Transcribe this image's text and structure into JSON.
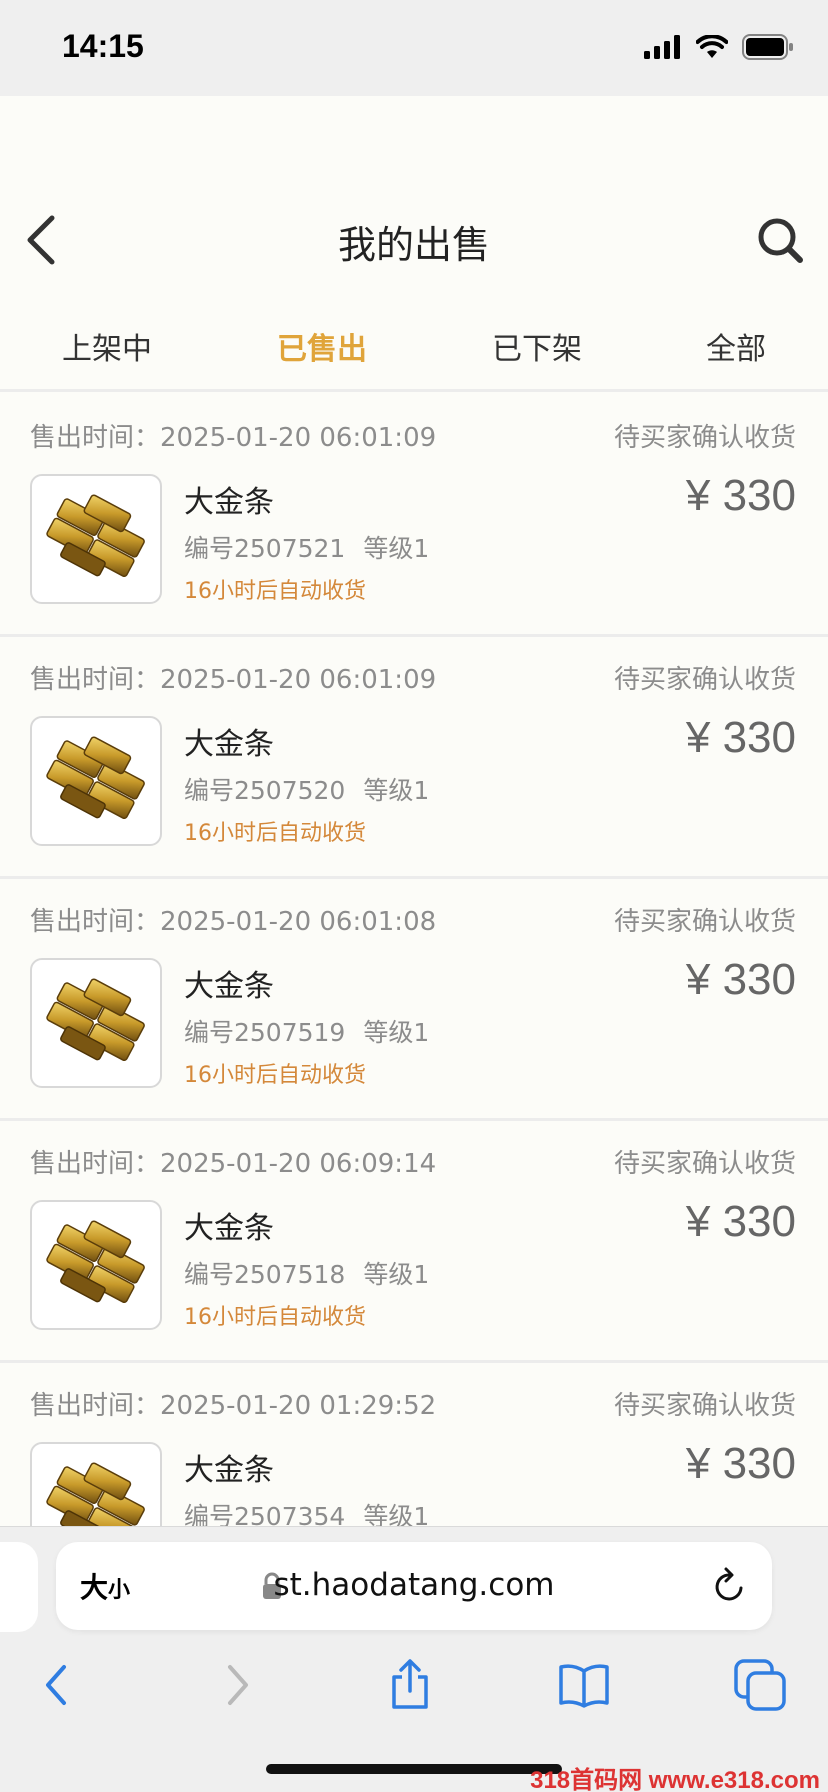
{
  "status_bar": {
    "time": "14:15"
  },
  "header": {
    "title": "我的出售"
  },
  "tabs": [
    {
      "label": "上架中",
      "active": false
    },
    {
      "label": "已售出",
      "active": true
    },
    {
      "label": "已下架",
      "active": false
    },
    {
      "label": "全部",
      "active": false
    }
  ],
  "orders": [
    {
      "time_label": "售出时间：",
      "time": "2025-01-20 06:01:09",
      "status": "待买家确认收货",
      "name": "大金条",
      "serial": "编号2507521",
      "level": "等级1",
      "auto_note": "16小时后自动收货",
      "price": "¥ 330"
    },
    {
      "time_label": "售出时间：",
      "time": "2025-01-20 06:01:09",
      "status": "待买家确认收货",
      "name": "大金条",
      "serial": "编号2507520",
      "level": "等级1",
      "auto_note": "16小时后自动收货",
      "price": "¥ 330"
    },
    {
      "time_label": "售出时间：",
      "time": "2025-01-20 06:01:08",
      "status": "待买家确认收货",
      "name": "大金条",
      "serial": "编号2507519",
      "level": "等级1",
      "auto_note": "16小时后自动收货",
      "price": "¥ 330"
    },
    {
      "time_label": "售出时间：",
      "time": "2025-01-20 06:09:14",
      "status": "待买家确认收货",
      "name": "大金条",
      "serial": "编号2507518",
      "level": "等级1",
      "auto_note": "16小时后自动收货",
      "price": "¥ 330"
    },
    {
      "time_label": "售出时间：",
      "time": "2025-01-20 01:29:52",
      "status": "待买家确认收货",
      "name": "大金条",
      "serial": "编号2507354",
      "level": "等级1",
      "auto_note": "",
      "price": "¥ 330"
    }
  ],
  "browser": {
    "text_size_big": "大",
    "text_size_small": "小",
    "url": "st.haodatang.com"
  },
  "watermark": "318首码网 www.e318.com",
  "colors": {
    "accent": "#e0a43a",
    "auto_note": "#d4883a",
    "muted": "#8c8c8c",
    "ios_blue": "#2f7de1"
  },
  "icons": [
    "back-icon",
    "search-icon",
    "gold-bar-icon",
    "lock-icon",
    "reload-icon",
    "share-icon",
    "bookmarks-icon",
    "tabs-icon"
  ]
}
